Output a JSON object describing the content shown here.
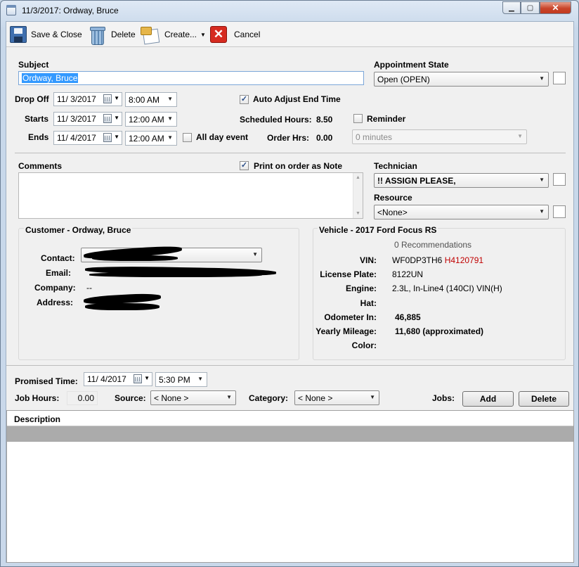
{
  "window": {
    "title": "11/3/2017: Ordway, Bruce",
    "min_glyph": "▁",
    "max_glyph": "▢",
    "close_glyph": "✕"
  },
  "toolbar": {
    "save_close": "Save & Close",
    "delete": "Delete",
    "create": "Create...",
    "cancel": "Cancel",
    "cancel_glyph": "✕",
    "caret": "▼"
  },
  "form": {
    "subject_label": "Subject",
    "subject_value": "Ordway, Bruce",
    "appt_state_label": "Appointment State",
    "appt_state_value": "Open (OPEN)",
    "dropoff_label": "Drop Off",
    "dropoff_date": "11/  3/2017",
    "dropoff_time": "8:00 AM",
    "starts_label": "Starts",
    "starts_date": "11/  3/2017",
    "starts_time": "12:00 AM",
    "ends_label": "Ends",
    "ends_date": "11/  4/2017",
    "ends_time": "12:00 AM",
    "all_day_label": "All day event",
    "auto_adjust_label": "Auto Adjust End Time",
    "auto_adjust_checked": "✓",
    "sched_hours_label": "Scheduled Hours:",
    "sched_hours_value": "8.50",
    "order_hrs_label": "Order Hrs:",
    "order_hrs_value": "0.00",
    "reminder_label": "Reminder",
    "reminder_value": "0 minutes",
    "comments_label": "Comments",
    "print_note_label": "Print on order as Note",
    "print_note_checked": "✓",
    "technician_label": "Technician",
    "technician_value": "!! ASSIGN PLEASE,",
    "resource_label": "Resource",
    "resource_value": "<None>"
  },
  "customer": {
    "header": "Customer - Ordway, Bruce",
    "contact_label": "Contact:",
    "email_label": "Email:",
    "company_label": "Company:",
    "company_value": "--",
    "address_label": "Address:"
  },
  "vehicle": {
    "header": "Vehicle - 2017 Ford Focus RS",
    "recommendations": "0 Recommendations",
    "vin_label": "VIN:",
    "vin_value_a": "WF0DP3TH6",
    "vin_value_b": "H4120791",
    "plate_label": "License Plate:",
    "plate_value": "8122UN",
    "engine_label": "Engine:",
    "engine_value": "2.3L, In-Line4 (140CI) VIN(H)",
    "hat_label": "Hat:",
    "odometer_label": "Odometer In:",
    "odometer_value": "46,885",
    "yearly_label": "Yearly Mileage:",
    "yearly_value": "11,680 (approximated)",
    "color_label": "Color:"
  },
  "bottom": {
    "promised_label": "Promised Time:",
    "promised_date": "11/  4/2017",
    "promised_time": "5:30 PM",
    "job_hours_label": "Job Hours:",
    "job_hours_value": "0.00",
    "source_label": "Source:",
    "source_value": "< None >",
    "category_label": "Category:",
    "category_value": "< None >",
    "jobs_label": "Jobs:",
    "add_label": "Add",
    "delete_label": "Delete",
    "grid_header": "Description"
  }
}
